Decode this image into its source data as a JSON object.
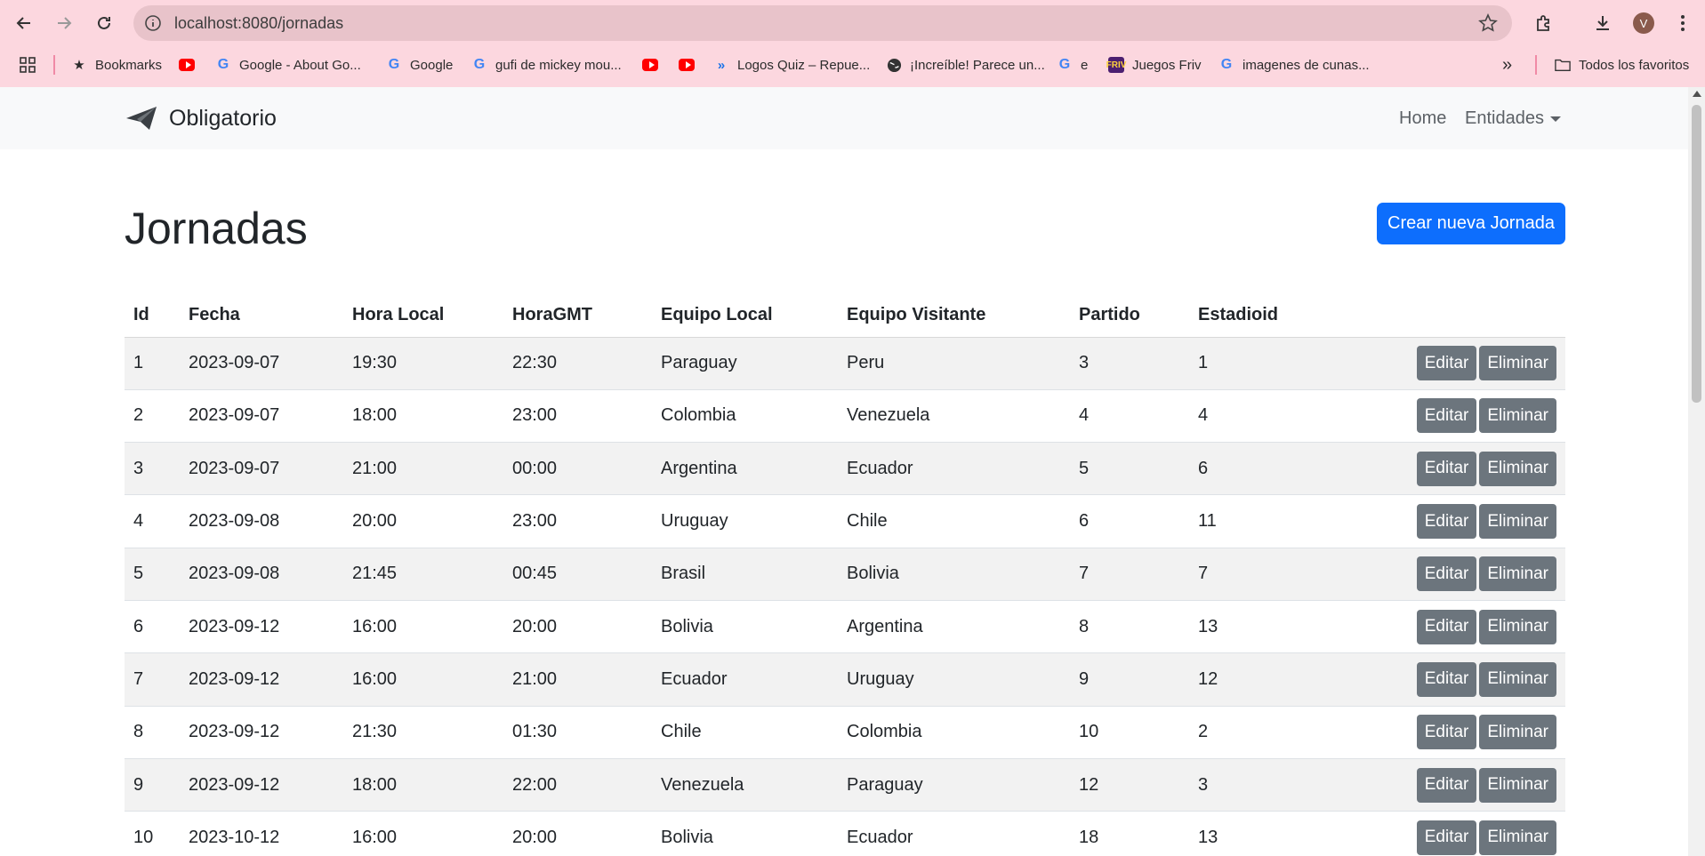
{
  "browser": {
    "url": "localhost:8080/jornadas",
    "avatar_letter": "V",
    "bookmarks": [
      {
        "label": "Bookmarks",
        "icon": "star-icon"
      },
      {
        "label": "",
        "icon": "youtube-icon"
      },
      {
        "label": "Google - About Go...",
        "icon": "google-icon"
      },
      {
        "label": "Google",
        "icon": "google-icon"
      },
      {
        "label": "gufi de mickey mou...",
        "icon": "google-icon"
      },
      {
        "label": "",
        "icon": "youtube-icon"
      },
      {
        "label": "",
        "icon": "youtube-icon"
      },
      {
        "label": "Logos Quiz – Repue...",
        "icon": "chevrons-icon"
      },
      {
        "label": "¡Increíble! Parece un...",
        "icon": "globe-icon"
      },
      {
        "label": "e",
        "icon": "google-icon"
      },
      {
        "label": "Juegos Friv",
        "icon": "friv-icon"
      },
      {
        "label": "imagenes de cunas...",
        "icon": "google-icon"
      }
    ],
    "all_bookmarks": "Todos los favoritos"
  },
  "navbar": {
    "brand": "Obligatorio",
    "home": "Home",
    "entities": "Entidades"
  },
  "page": {
    "title": "Jornadas",
    "create_button": "Crear nueva Jornada"
  },
  "table": {
    "headers": [
      "Id",
      "Fecha",
      "Hora Local",
      "HoraGMT",
      "Equipo Local",
      "Equipo Visitante",
      "Partido",
      "Estadioid"
    ],
    "edit_label": "Editar",
    "delete_label": "Eliminar",
    "rows": [
      [
        "1",
        "2023-09-07",
        "19:30",
        "22:30",
        "Paraguay",
        "Peru",
        "3",
        "1"
      ],
      [
        "2",
        "2023-09-07",
        "18:00",
        "23:00",
        "Colombia",
        "Venezuela",
        "4",
        "4"
      ],
      [
        "3",
        "2023-09-07",
        "21:00",
        "00:00",
        "Argentina",
        "Ecuador",
        "5",
        "6"
      ],
      [
        "4",
        "2023-09-08",
        "20:00",
        "23:00",
        "Uruguay",
        "Chile",
        "6",
        "11"
      ],
      [
        "5",
        "2023-09-08",
        "21:45",
        "00:45",
        "Brasil",
        "Bolivia",
        "7",
        "7"
      ],
      [
        "6",
        "2023-09-12",
        "16:00",
        "20:00",
        "Bolivia",
        "Argentina",
        "8",
        "13"
      ],
      [
        "7",
        "2023-09-12",
        "16:00",
        "21:00",
        "Ecuador",
        "Uruguay",
        "9",
        "12"
      ],
      [
        "8",
        "2023-09-12",
        "21:30",
        "01:30",
        "Chile",
        "Colombia",
        "10",
        "2"
      ],
      [
        "9",
        "2023-09-12",
        "18:00",
        "22:00",
        "Venezuela",
        "Paraguay",
        "12",
        "3"
      ],
      [
        "10",
        "2023-10-12",
        "16:00",
        "20:00",
        "Bolivia",
        "Ecuador",
        "18",
        "13"
      ]
    ]
  },
  "colors": {
    "chrome_bg": "#fcd7df",
    "primary": "#0d6efd",
    "secondary": "#6c757d"
  }
}
